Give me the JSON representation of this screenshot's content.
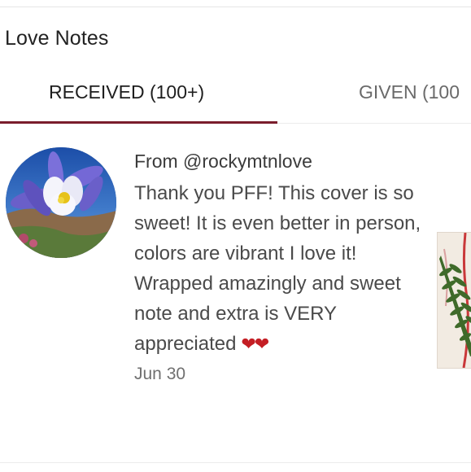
{
  "header": {
    "title": "Love Notes"
  },
  "tabs": [
    {
      "label": "RECEIVED (100+)",
      "active": true
    },
    {
      "label": "GIVEN (100",
      "active": false
    }
  ],
  "note": {
    "from": "From @rockymtnlove",
    "body": "Thank you PFF! This cover is so sweet! It is even better in person, colors are vibrant I love it! Wrapped amazingly and sweet note and extra is VERY appreciated",
    "hearts": "❤❤",
    "date": "Jun 30"
  },
  "colors": {
    "accent": "#7a1d2c",
    "heart": "#c41e24"
  },
  "icons": {
    "avatar": "columbine-flower-avatar",
    "thumbnail": "fern-cover-thumbnail"
  }
}
